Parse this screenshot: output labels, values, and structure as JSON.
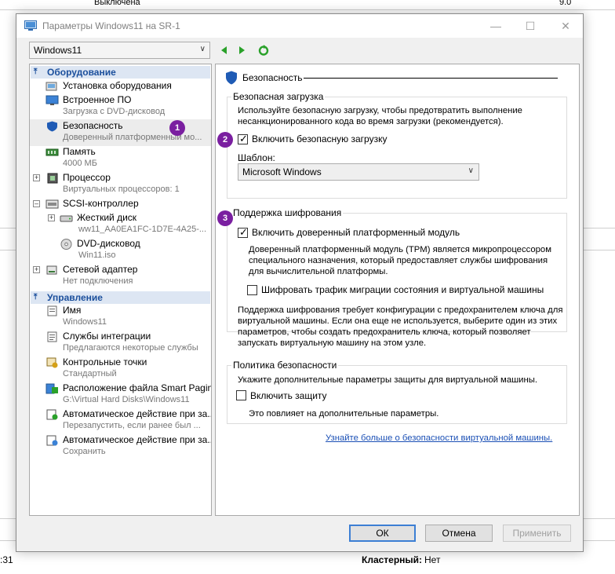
{
  "background": {
    "top_row_label": "Выключена",
    "top_row_value": "9.0",
    "bottom_left_text": ":31",
    "cluster_label": "Кластерный:",
    "cluster_value": "Нет"
  },
  "dialog": {
    "title": "Параметры Windows11 на SR-1",
    "vm_selector": "Windows11",
    "colors": {
      "accent": "#3c7fd4",
      "badge": "#7a1fa0",
      "section_bg": "#dde6f3",
      "section_text": "#1b4f9c"
    }
  },
  "tree": {
    "hardware_section": "Оборудование",
    "management_section": "Управление",
    "items": [
      {
        "label": "Установка оборудования",
        "sub": "",
        "icon": "add-hardware-icon"
      },
      {
        "label": "Встроенное ПО",
        "sub": "Загрузка с DVD-дисковод",
        "icon": "firmware-icon"
      },
      {
        "label": "Безопасность",
        "sub": "Доверенный платформенный мо...",
        "icon": "shield-icon"
      },
      {
        "label": "Память",
        "sub": "4000 МБ",
        "icon": "memory-icon"
      },
      {
        "label": "Процессор",
        "sub": "Виртуальных процессоров: 1",
        "icon": "cpu-icon"
      },
      {
        "label": "SCSI-контроллер",
        "sub": "",
        "icon": "scsi-icon"
      },
      {
        "label": "Жесткий диск",
        "sub": "ww11_AA0EA1FC-1D7E-4A25-...",
        "icon": "hard-disk-icon"
      },
      {
        "label": "DVD-дисковод",
        "sub": "Win11.iso",
        "icon": "dvd-icon"
      },
      {
        "label": "Сетевой адаптер",
        "sub": "Нет подключения",
        "icon": "network-adapter-icon"
      },
      {
        "label": "Имя",
        "sub": "Windows11",
        "icon": "name-icon"
      },
      {
        "label": "Службы интеграции",
        "sub": "Предлагаются некоторые службы",
        "icon": "integration-icon"
      },
      {
        "label": "Контрольные точки",
        "sub": "Стандартный",
        "icon": "checkpoint-icon"
      },
      {
        "label": "Расположение файла Smart Paging",
        "sub": "G:\\Virtual Hard Disks\\Windows11",
        "icon": "smart-paging-icon"
      },
      {
        "label": "Автоматическое действие при за...",
        "sub": "Перезапустить, если ранее был ...",
        "icon": "auto-start-icon"
      },
      {
        "label": "Автоматическое действие при за...",
        "sub": "Сохранить",
        "icon": "auto-stop-icon"
      }
    ]
  },
  "panel": {
    "title": "Безопасность",
    "secure_boot": {
      "group_title": "Безопасная загрузка",
      "description": "Используйте безопасную загрузку, чтобы предотвратить выполнение несанкционированного кода во время загрузки (рекомендуется).",
      "checkbox_label": "Включить безопасную загрузку",
      "checked": true,
      "template_label": "Шаблон:",
      "template_value": "Microsoft Windows"
    },
    "encryption": {
      "group_title": "Поддержка шифрования",
      "tpm_label": "Включить доверенный платформенный модуль",
      "tpm_checked": true,
      "tpm_description": "Доверенный платформенный модуль (TPM) является микропроцессором специального назначения, который предоставляет службы шифрования для вычислительной платформы.",
      "migration_label": "Шифровать трафик миграции состояния и виртуальной машины",
      "migration_checked": false,
      "note": "Поддержка шифрования требует конфигурации с предохранителем ключа для виртуальной машины. Если она еще не используется, выберите один из этих параметров, чтобы создать предохранитель ключа, который позволяет запускать виртуальную машину на этом узле."
    },
    "policy": {
      "group_title": "Политика безопасности",
      "description": "Укажите дополнительные параметры защиты для виртуальной машины.",
      "shield_label": "Включить защиту",
      "shield_checked": false,
      "note": "Это повлияет на дополнительные параметры."
    },
    "learn_more_link": "Узнайте больше о безопасности виртуальной машины."
  },
  "badges": [
    "1",
    "2",
    "3"
  ],
  "buttons": {
    "ok": "ОК",
    "cancel": "Отмена",
    "apply": "Применить"
  }
}
